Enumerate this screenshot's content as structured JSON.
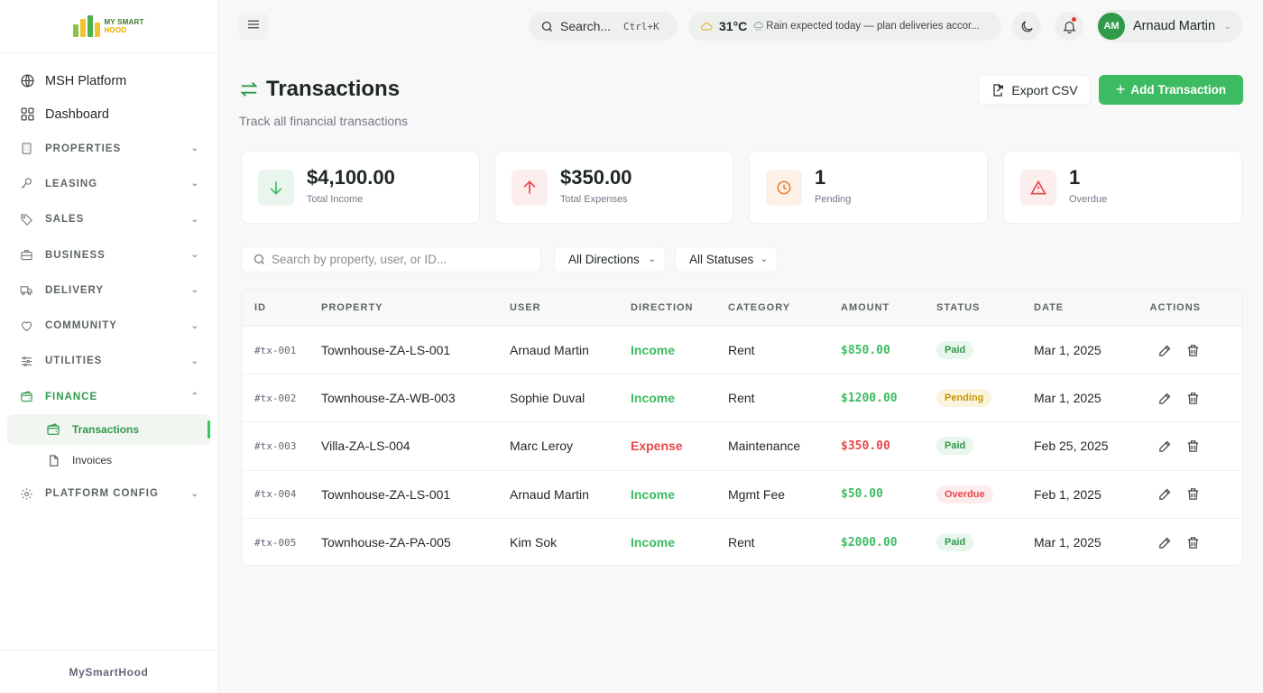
{
  "brand": {
    "line1": "MY SMART",
    "line2": "HOOD",
    "footer": "MySmartHood"
  },
  "sidebar": {
    "top_items": [
      {
        "label": "MSH Platform",
        "icon": "globe-icon"
      },
      {
        "label": "Dashboard",
        "icon": "grid-icon"
      }
    ],
    "sections": [
      {
        "label": "PROPERTIES",
        "icon": "building-icon"
      },
      {
        "label": "LEASING",
        "icon": "key-icon"
      },
      {
        "label": "SALES",
        "icon": "tag-icon"
      },
      {
        "label": "BUSINESS",
        "icon": "briefcase-icon"
      },
      {
        "label": "DELIVERY",
        "icon": "truck-icon"
      },
      {
        "label": "COMMUNITY",
        "icon": "heart-icon"
      },
      {
        "label": "UTILITIES",
        "icon": "sliders-icon"
      },
      {
        "label": "FINANCE",
        "icon": "wallet-icon",
        "active": true
      },
      {
        "label": "PLATFORM CONFIG",
        "icon": "gear-icon"
      }
    ],
    "finance_items": [
      {
        "label": "Transactions",
        "icon": "wallet-icon",
        "active": true
      },
      {
        "label": "Invoices",
        "icon": "document-icon"
      }
    ]
  },
  "topbar": {
    "search_label": "Search...",
    "search_shortcut": "Ctrl+K",
    "weather_temp": "31°C",
    "weather_message": "Rain expected today — plan deliveries accor...",
    "user_initials": "AM",
    "user_name": "Arnaud Martin"
  },
  "page": {
    "title": "Transactions",
    "subtitle": "Track all financial transactions",
    "export_label": "Export CSV",
    "add_label": "Add Transaction"
  },
  "stats": [
    {
      "value": "$4,100.00",
      "label": "Total Income",
      "icon": "arrow-down-icon",
      "color": "#3dbb62",
      "bg": "#eaf6ed"
    },
    {
      "value": "$350.00",
      "label": "Total Expenses",
      "icon": "arrow-up-icon",
      "color": "#e5484d",
      "bg": "#fdeeee"
    },
    {
      "value": "1",
      "label": "Pending",
      "icon": "clock-icon",
      "color": "#e8833a",
      "bg": "#fdf1e7"
    },
    {
      "value": "1",
      "label": "Overdue",
      "icon": "alert-icon",
      "color": "#e5484d",
      "bg": "#fdeeee"
    }
  ],
  "filters": {
    "search_placeholder": "Search by property, user, or ID...",
    "direction": "All Directions",
    "status": "All Statuses"
  },
  "table": {
    "headers": [
      "ID",
      "PROPERTY",
      "USER",
      "DIRECTION",
      "CATEGORY",
      "AMOUNT",
      "STATUS",
      "DATE",
      "ACTIONS"
    ],
    "rows": [
      {
        "id": "#tx-001",
        "property": "Townhouse-ZA-LS-001",
        "user": "Arnaud Martin",
        "direction": "Income",
        "category": "Rent",
        "amount": "$850.00",
        "status": "Paid",
        "date": "Mar 1, 2025"
      },
      {
        "id": "#tx-002",
        "property": "Townhouse-ZA-WB-003",
        "user": "Sophie Duval",
        "direction": "Income",
        "category": "Rent",
        "amount": "$1200.00",
        "status": "Pending",
        "date": "Mar 1, 2025"
      },
      {
        "id": "#tx-003",
        "property": "Villa-ZA-LS-004",
        "user": "Marc Leroy",
        "direction": "Expense",
        "category": "Maintenance",
        "amount": "$350.00",
        "status": "Paid",
        "date": "Feb 25, 2025"
      },
      {
        "id": "#tx-004",
        "property": "Townhouse-ZA-LS-001",
        "user": "Arnaud Martin",
        "direction": "Income",
        "category": "Mgmt Fee",
        "amount": "$50.00",
        "status": "Overdue",
        "date": "Feb 1, 2025"
      },
      {
        "id": "#tx-005",
        "property": "Townhouse-ZA-PA-005",
        "user": "Kim Sok",
        "direction": "Income",
        "category": "Rent",
        "amount": "$2000.00",
        "status": "Paid",
        "date": "Mar 1, 2025"
      }
    ]
  }
}
